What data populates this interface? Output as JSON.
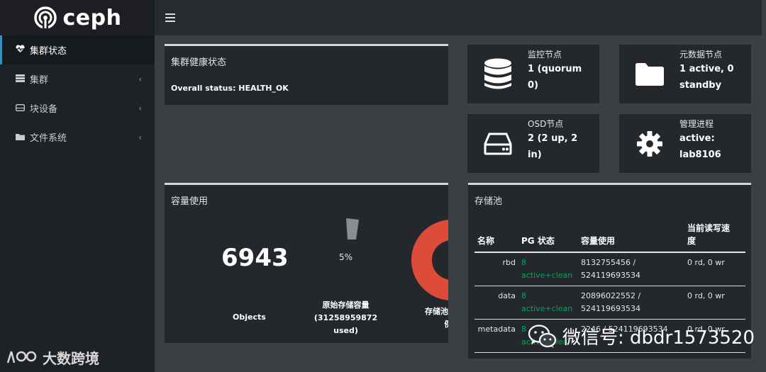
{
  "brand": {
    "name": "ceph"
  },
  "sidebar": {
    "items": [
      {
        "label": "集群状态",
        "icon": "heartbeat-icon",
        "active": true,
        "has_children": false
      },
      {
        "label": "集群",
        "icon": "server-icon",
        "active": false,
        "has_children": true
      },
      {
        "label": "块设备",
        "icon": "hdd-icon",
        "active": false,
        "has_children": true
      },
      {
        "label": "文件系统",
        "icon": "folder-icon",
        "active": false,
        "has_children": true
      }
    ]
  },
  "health": {
    "title": "集群健康状态",
    "status": "Overall status: HEALTH_OK"
  },
  "info_boxes": {
    "monitors": {
      "label": "监控节点",
      "value_line1": "1 (quorum",
      "value_line2": "0)"
    },
    "mds": {
      "label": "元数据节点",
      "value_line1": "1 active, 0",
      "value_line2": "standby"
    },
    "osd": {
      "label": "OSD节点",
      "value_line1": "2 (2 up, 2",
      "value_line2": "in)"
    },
    "mgr": {
      "label": "管理进程",
      "value_line1": "active:",
      "value_line2": "lab8106"
    }
  },
  "capacity": {
    "title": "容量使用",
    "objects_count": "6943",
    "objects_label": "Objects",
    "raw_percent": "5%",
    "raw_percent_value": 5,
    "raw_label_line1": "原始存储容量",
    "raw_label_line2": "(31258959872",
    "raw_label_line3": "used)",
    "pool_ratio_label_line1": "存储池容量使",
    "pool_ratio_label_line2": "例",
    "pool_ratio_share": 0.06
  },
  "pools": {
    "title": "存储池",
    "headers": {
      "name": "名称",
      "pg": "PG 状态",
      "usage": "容量使用",
      "rw_line1": "当前读写速",
      "rw_line2": "度"
    },
    "rows": [
      {
        "name": "rbd",
        "pg_count": "8",
        "pg_state": "active+clean",
        "used": "8132755456 /",
        "total": "524119693534",
        "rw": "0 rd, 0 wr"
      },
      {
        "name": "data",
        "pg_count": "8",
        "pg_state": "active+clean",
        "used": "20896022552 /",
        "total": "524119693534",
        "rw": "0 rd, 0 wr"
      },
      {
        "name": "metadata",
        "pg_count": "8",
        "pg_state": "active+clean",
        "used": "2246 / 524119693534",
        "total": "",
        "rw": "0 rd, 0 wr"
      }
    ]
  },
  "watermarks": {
    "left_brand": "大数跨境",
    "right_wechat": "微信号: dbdr1573520"
  },
  "colors": {
    "accent": "#3c8dbc",
    "donut_red": "#dd4b39",
    "donut_blue": "#3c8dbc",
    "green": "#00a65a"
  }
}
